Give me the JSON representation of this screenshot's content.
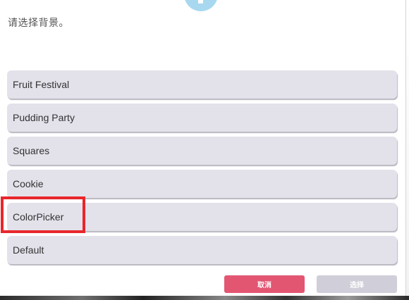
{
  "dialog": {
    "prompt": "请选择背景。",
    "icon": "info-icon"
  },
  "options": [
    {
      "label": "Fruit Festival"
    },
    {
      "label": "Pudding Party"
    },
    {
      "label": "Squares"
    },
    {
      "label": "Cookie"
    },
    {
      "label": "ColorPicker",
      "highlighted": true
    },
    {
      "label": "Default"
    }
  ],
  "buttons": {
    "cancel_label": "取消",
    "select_label": "选择"
  },
  "colors": {
    "option_bg": "#e3e1ea",
    "cancel_bg": "#e25672",
    "select_bg": "#cfced9",
    "highlight_border": "#e8262b",
    "icon_bg": "#a7d8f0"
  }
}
